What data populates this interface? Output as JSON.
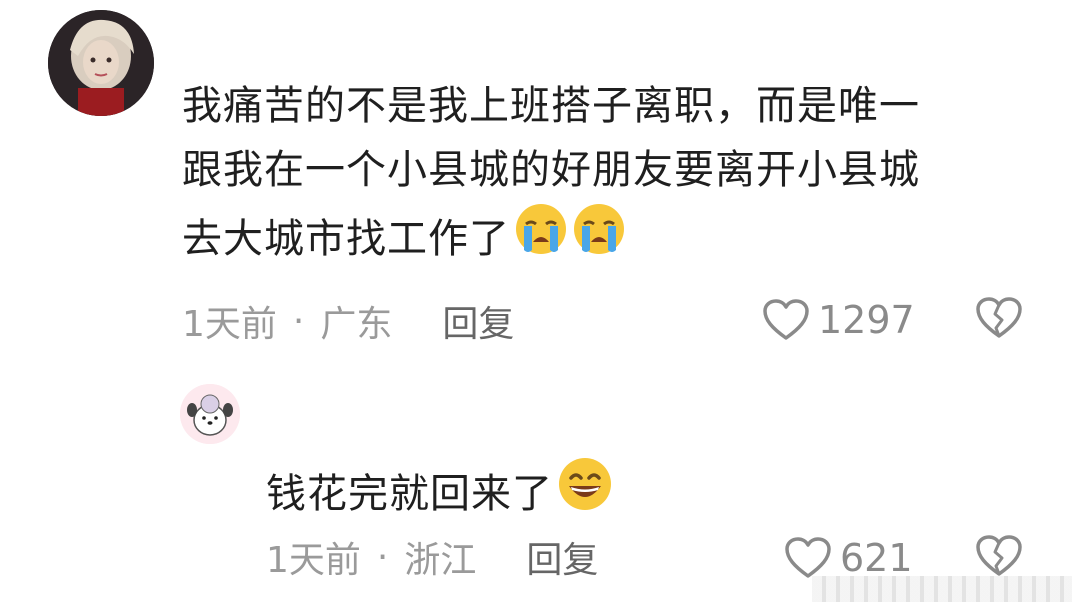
{
  "comments": [
    {
      "text_lines": [
        "我痛苦的不是我上班搭子离职，而是唯一",
        "跟我在一个小县城的好朋友要离开小县城",
        "去大城市找工作了"
      ],
      "emojis": [
        "loudly-crying-face-icon",
        "loudly-crying-face-icon"
      ],
      "time": "1天前",
      "separator": "·",
      "location": "广东",
      "reply_label": "回复",
      "like_count": "1297"
    },
    {
      "text": "钱花完就回来了",
      "emojis": [
        "grinning-face-icon"
      ],
      "time": "1天前",
      "separator": "·",
      "location": "浙江",
      "reply_label": "回复",
      "like_count": "621"
    }
  ],
  "colors": {
    "text": "#1f1f1f",
    "meta": "#9a9a9a",
    "icon": "#8a8a8a"
  }
}
